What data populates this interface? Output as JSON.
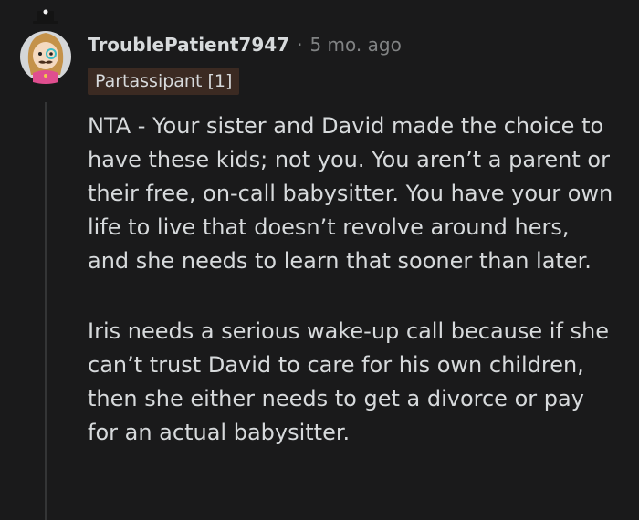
{
  "comment": {
    "author": "TroublePatient7947",
    "separator": "·",
    "time_ago": "5 mo. ago",
    "flair": "Partassipant [1]",
    "paragraphs": [
      "NTA - Your sister and David made the choice to have these kids; not you. You aren’t a parent or their free, on-call babysitter. You have your own life to live that doesn’t revolve around hers, and she needs to learn that sooner than later.",
      "Iris needs a serious wake-up call because if she can’t trust David to care for his own children, then she either needs to get a divorce or pay for an actual babysitter."
    ]
  },
  "colors": {
    "background": "#1a1a1b",
    "text": "#d7dadc",
    "meta": "#818384",
    "flair_bg": "#3b2a22",
    "thread_line": "#343536"
  },
  "icons": {
    "avatar": "user-avatar-snoo"
  }
}
